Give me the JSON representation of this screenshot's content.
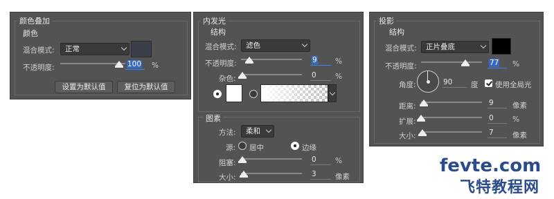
{
  "color_overlay": {
    "group_title": "颜色叠加",
    "section_title": "颜色",
    "blend_mode_label": "混合模式:",
    "blend_mode_value": "正常",
    "opacity_label": "不透明度:",
    "opacity_value": "100",
    "opacity_unit": "%",
    "opacity_level": 1.0,
    "swatch_color": "#3b3f4a",
    "set_default_button": "设置为默认值",
    "reset_default_button": "复位为默认值"
  },
  "inner_glow": {
    "group_title": "内发光",
    "section_title": "结构",
    "blend_mode_label": "混合模式:",
    "blend_mode_value": "滤色",
    "opacity_label": "不透明度:",
    "opacity_value": "9",
    "opacity_unit": "%",
    "opacity_level": 0.09,
    "noise_label": "杂色:",
    "noise_value": "0",
    "noise_unit": "%",
    "noise_level": 0.0,
    "elements_title": "图素",
    "method_label": "方法:",
    "method_value": "柔和",
    "source_label": "源:",
    "source_center": "居中",
    "source_edge": "边缘",
    "choke_label": "阻塞:",
    "choke_value": "0",
    "choke_unit": "%",
    "choke_level": 0.0,
    "size_label": "大小:",
    "size_value": "3",
    "size_unit": "像素",
    "size_level": 0.02
  },
  "drop_shadow": {
    "group_title": "投影",
    "section_title": "结构",
    "blend_mode_label": "混合模式:",
    "blend_mode_value": "正片叠底",
    "swatch_color": "#000000",
    "opacity_label": "不透明度:",
    "opacity_value": "77",
    "opacity_unit": "%",
    "opacity_level": 0.77,
    "angle_label": "角度:",
    "angle_value": "90",
    "angle_unit": "度",
    "global_light_label": "使用全局光",
    "distance_label": "距离:",
    "distance_value": "9",
    "distance_unit": "像素",
    "distance_level": 0.04,
    "spread_label": "扩展:",
    "spread_value": "0",
    "spread_unit": "%",
    "spread_level": 0.0,
    "size_label": "大小:",
    "size_value": "7",
    "size_unit": "像素",
    "size_level": 0.03
  },
  "watermark": {
    "site": "fevte.com",
    "name": "飞特教程网"
  }
}
